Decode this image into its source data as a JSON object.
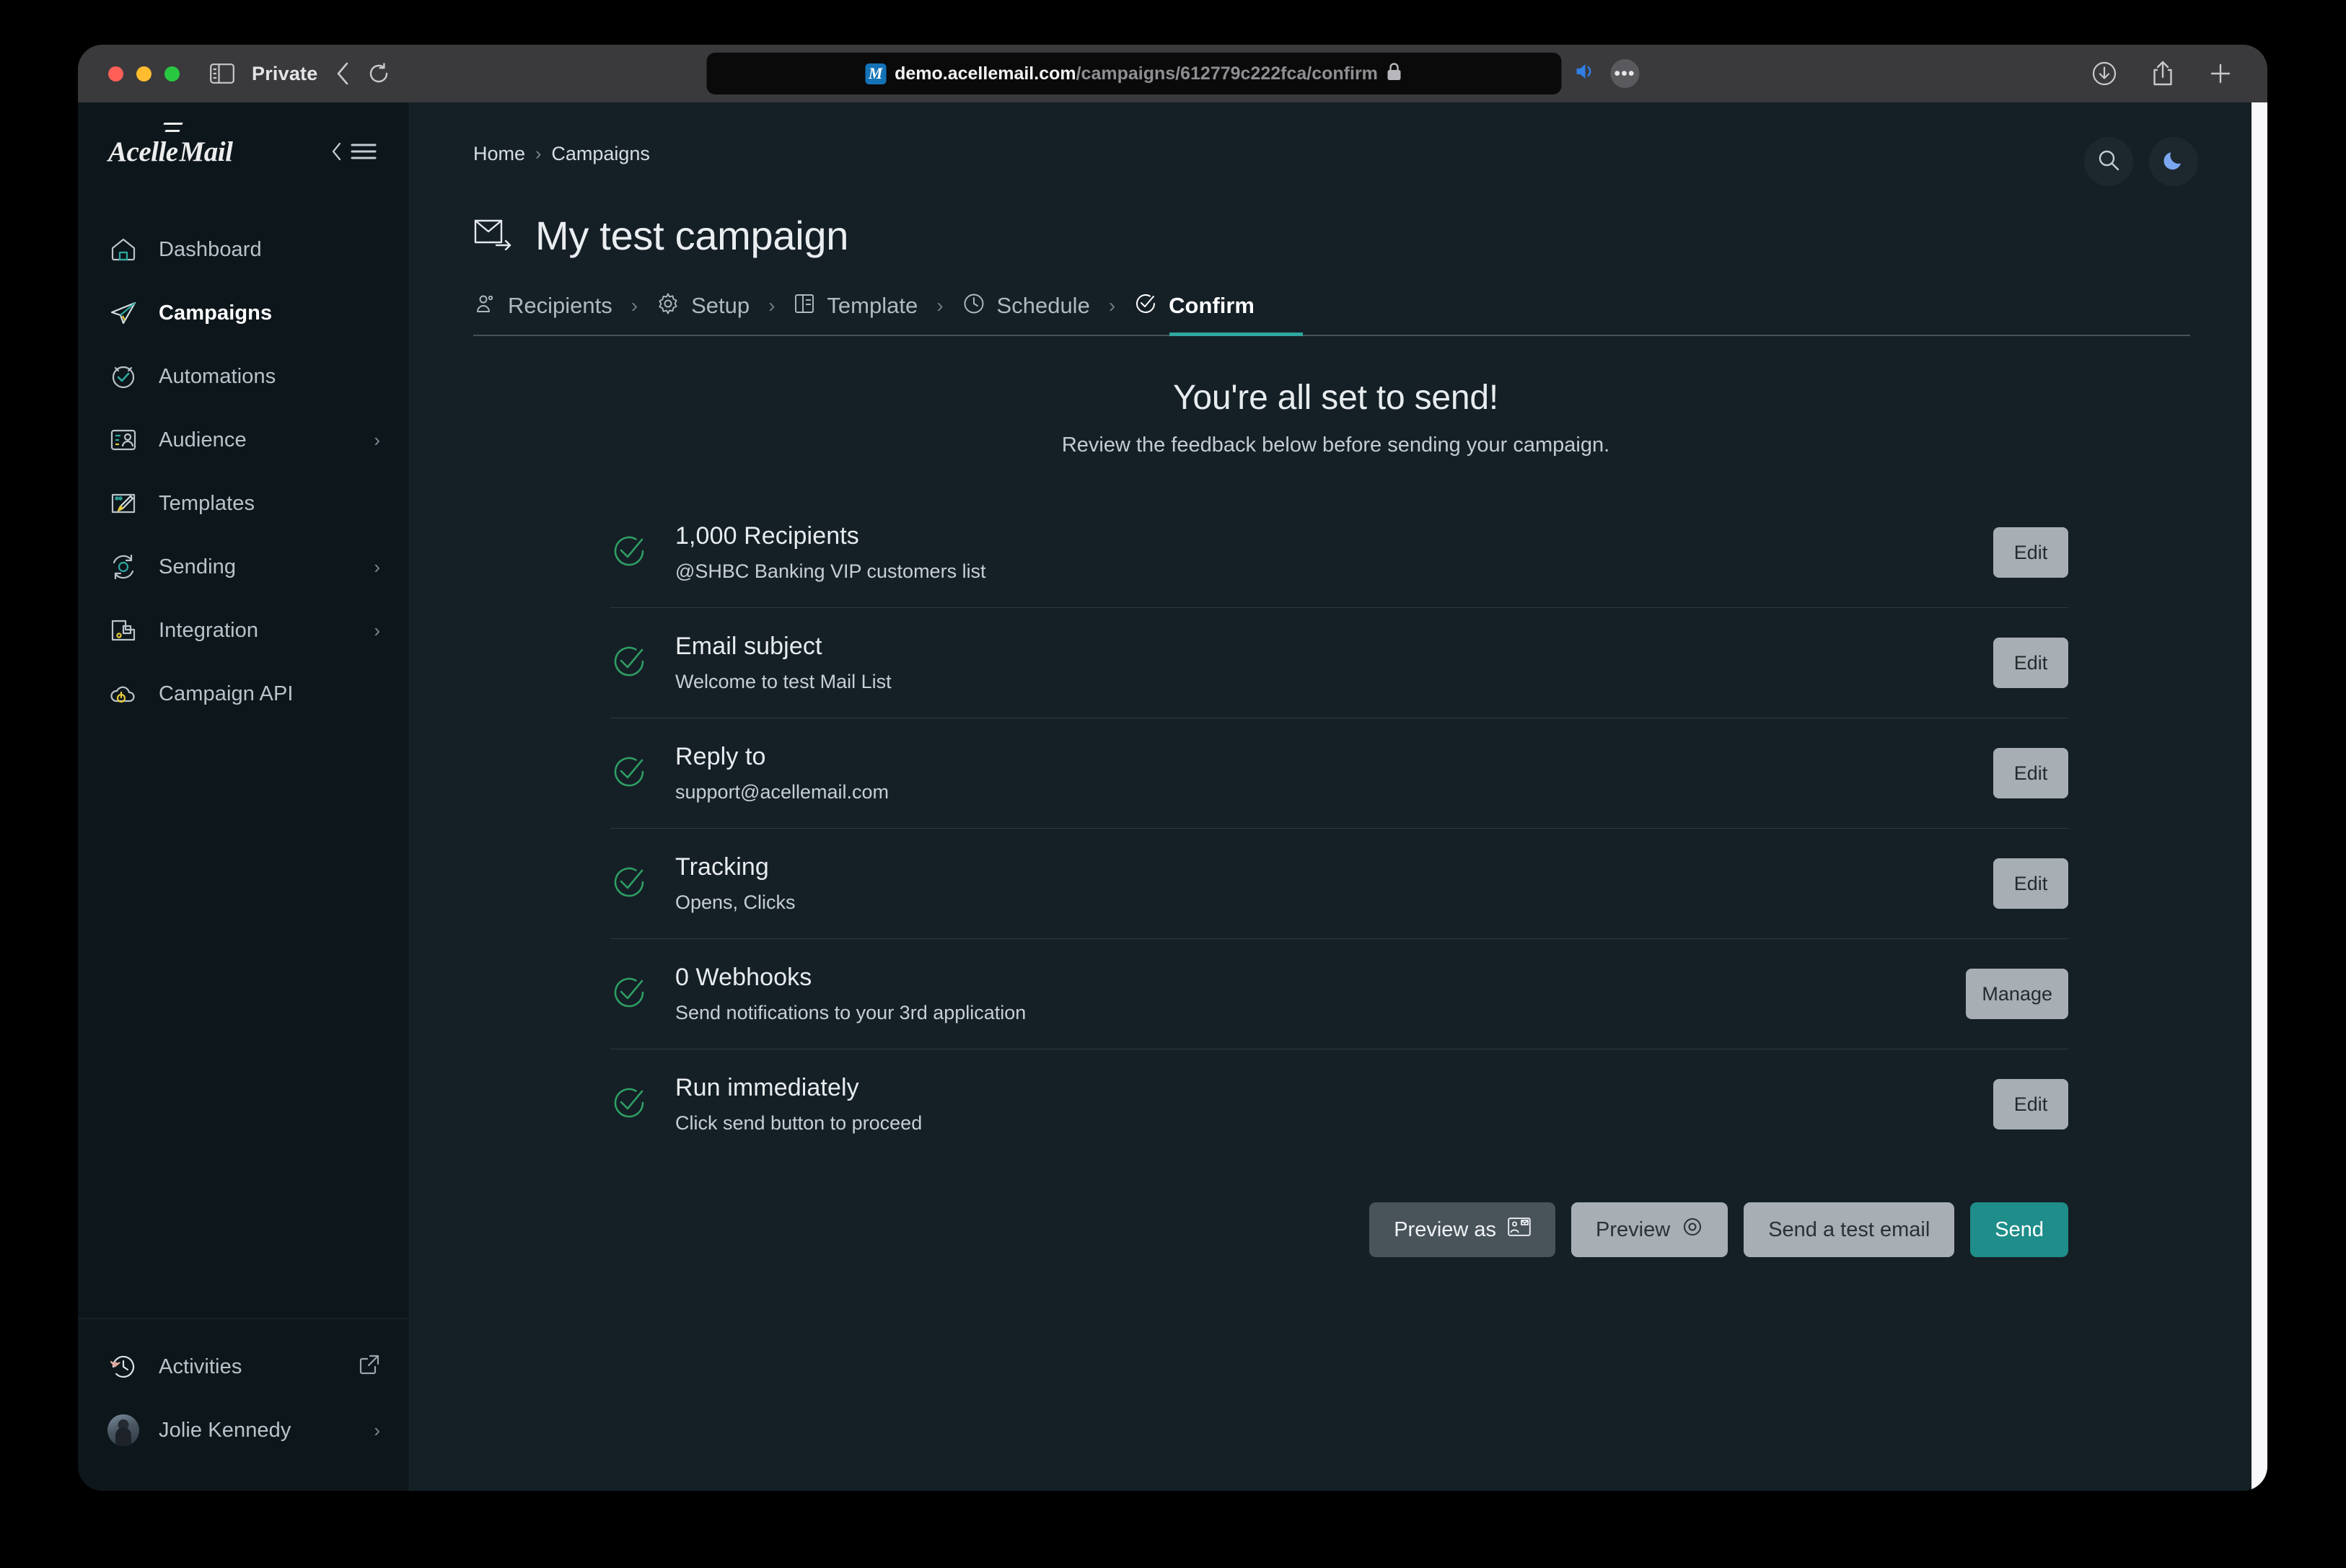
{
  "browser": {
    "private_label": "Private",
    "url_host": "demo.acellemail.com",
    "url_path": "/campaigns/612779c222fca/confirm",
    "favicon_letter": "M",
    "icons": {
      "sidebar": "sidebar-toggle-icon",
      "back": "back-chevron-icon",
      "reload": "reload-icon",
      "lock": "lock-icon",
      "speaker": "speaker-icon",
      "more": "more-ellipsis-icon",
      "download": "download-icon",
      "share": "share-icon",
      "newtab": "new-tab-plus-icon"
    }
  },
  "sidebar": {
    "brand_1": "Acelle",
    "brand_2": "Mail",
    "items": [
      {
        "label": "Dashboard",
        "icon": "home-icon",
        "chevron": "",
        "active": false
      },
      {
        "label": "Campaigns",
        "icon": "paper-plane-icon",
        "chevron": "",
        "active": true
      },
      {
        "label": "Automations",
        "icon": "clock-check-icon",
        "chevron": "",
        "active": false
      },
      {
        "label": "Audience",
        "icon": "audience-icon",
        "chevron": "›",
        "active": false
      },
      {
        "label": "Templates",
        "icon": "template-icon",
        "chevron": "",
        "active": false
      },
      {
        "label": "Sending",
        "icon": "sending-icon",
        "chevron": "›",
        "active": false
      },
      {
        "label": "Integration",
        "icon": "integration-icon",
        "chevron": "›",
        "active": false
      },
      {
        "label": "Campaign API",
        "icon": "api-gear-icon",
        "chevron": "",
        "active": false
      }
    ],
    "footer": {
      "activities_label": "Activities",
      "user_name": "Jolie Kennedy",
      "user_chevron": "›"
    }
  },
  "header": {
    "breadcrumb": {
      "home": "Home",
      "separator": "›",
      "current": "Campaigns"
    },
    "title": "My test campaign"
  },
  "steps": [
    {
      "label": "Recipients",
      "icon": "people-icon",
      "active": false
    },
    {
      "label": "Setup",
      "icon": "gear-icon",
      "active": false
    },
    {
      "label": "Template",
      "icon": "layout-icon",
      "active": false
    },
    {
      "label": "Schedule",
      "icon": "clock-icon",
      "active": false
    },
    {
      "label": "Confirm",
      "icon": "check-badge-icon",
      "active": true
    }
  ],
  "step_separator": "›",
  "hero": {
    "heading": "You're all set to send!",
    "subheading": "Review the feedback below before sending your campaign."
  },
  "checklist": [
    {
      "title": "1,000 Recipients",
      "subtitle": "@SHBC Banking VIP customers list",
      "action": "Edit"
    },
    {
      "title": "Email subject",
      "subtitle": "Welcome to test Mail List",
      "action": "Edit"
    },
    {
      "title": "Reply to",
      "subtitle": "support@acellemail.com",
      "action": "Edit"
    },
    {
      "title": "Tracking",
      "subtitle": "Opens, Clicks",
      "action": "Edit"
    },
    {
      "title": "0 Webhooks",
      "subtitle": "Send notifications to your 3rd application",
      "action": "Manage"
    },
    {
      "title": "Run immediately",
      "subtitle": "Click send button to proceed",
      "action": "Edit"
    }
  ],
  "actions": {
    "preview_as": "Preview as",
    "preview": "Preview",
    "send_test": "Send a test email",
    "send": "Send"
  },
  "colors": {
    "accent_teal": "#2FA8A0",
    "send_button": "#1F8D8A",
    "check_green": "#2E9E63",
    "moon_blue": "#7BA7F0",
    "app_bg": "#151F26",
    "sidebar_bg": "#0D161B"
  }
}
